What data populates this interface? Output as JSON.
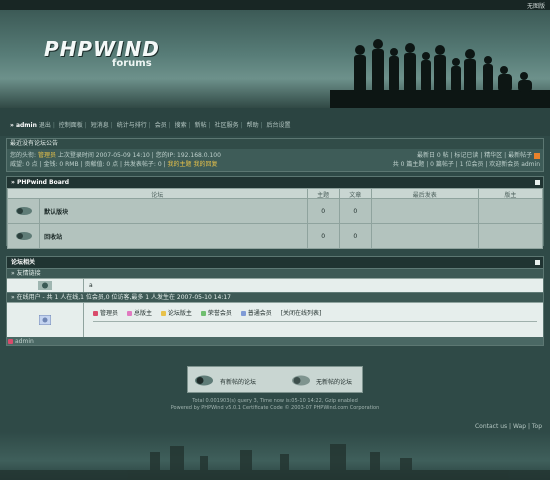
{
  "topbar": {
    "right_link": "无图版"
  },
  "banner": {
    "logo": "PHPWIND",
    "sub": "forums"
  },
  "menu": {
    "user": "» admin",
    "items": [
      "退出",
      "控制面板",
      "短消息",
      "统计与排行",
      "会员",
      "搜索",
      "新帖",
      "社区服务",
      "帮助",
      "后台设置"
    ]
  },
  "notice": {
    "title": "最近没有论坛公告",
    "line1_prefix": "您的头衔:",
    "line1_rank": "管理员",
    "line1_rest": "上次登录时间 2007-05-09 14:10 | 您的IP: 192.168.0.100",
    "line2": "威望: 0 点 | 金钱: 0 RMB | 贡献值: 0 点 | 共发表帖子: 0 |",
    "line2_link1": "我的主题",
    "line2_link2": "我的回复",
    "right1": "最新日 0 帖 | 标记已读 | 精华区 | 最新帖子",
    "right2": "共 0 篇主题 | 0 篇帖子 | 1 位会员 | 欢迎新会员 admin"
  },
  "board": {
    "title": "» PHPwind Board",
    "headers": [
      "论坛",
      "主题",
      "文章",
      "最后发表",
      "版主"
    ],
    "rows": [
      {
        "name": "默认版块",
        "topics": "0",
        "posts": "0"
      },
      {
        "name": "回收站",
        "topics": "0",
        "posts": "0"
      }
    ]
  },
  "related": {
    "title": "论坛相关",
    "links_title": "» 友情链接",
    "links_value": "a",
    "online_title": "» 在线用户 - 共 1 人在线,1 位会员,0 位访客,最多 1 人发生在 2007-05-10 14:17",
    "legend": [
      "管理员",
      "总版主",
      "论坛版主",
      "荣誉会员",
      "普通会员"
    ],
    "legend_close": "[关闭在线列表]",
    "online_user": "admin"
  },
  "legend_box": {
    "new": "有新帖的论坛",
    "nonew": "无新帖的论坛"
  },
  "footer": {
    "line1": "Total 0.001903(s) query 3, Time now is:05-10 14:22, Gzip enabled",
    "line2": "Powered by PHPWind v5.0.1 Certificate Code © 2003-07 PHPWind.com Corporation"
  },
  "bottom_links": [
    "Contact us",
    "Wap",
    "Top"
  ],
  "colors": {
    "accent": "#e8c24a",
    "header": "#203432",
    "rss": "#e8822b"
  }
}
